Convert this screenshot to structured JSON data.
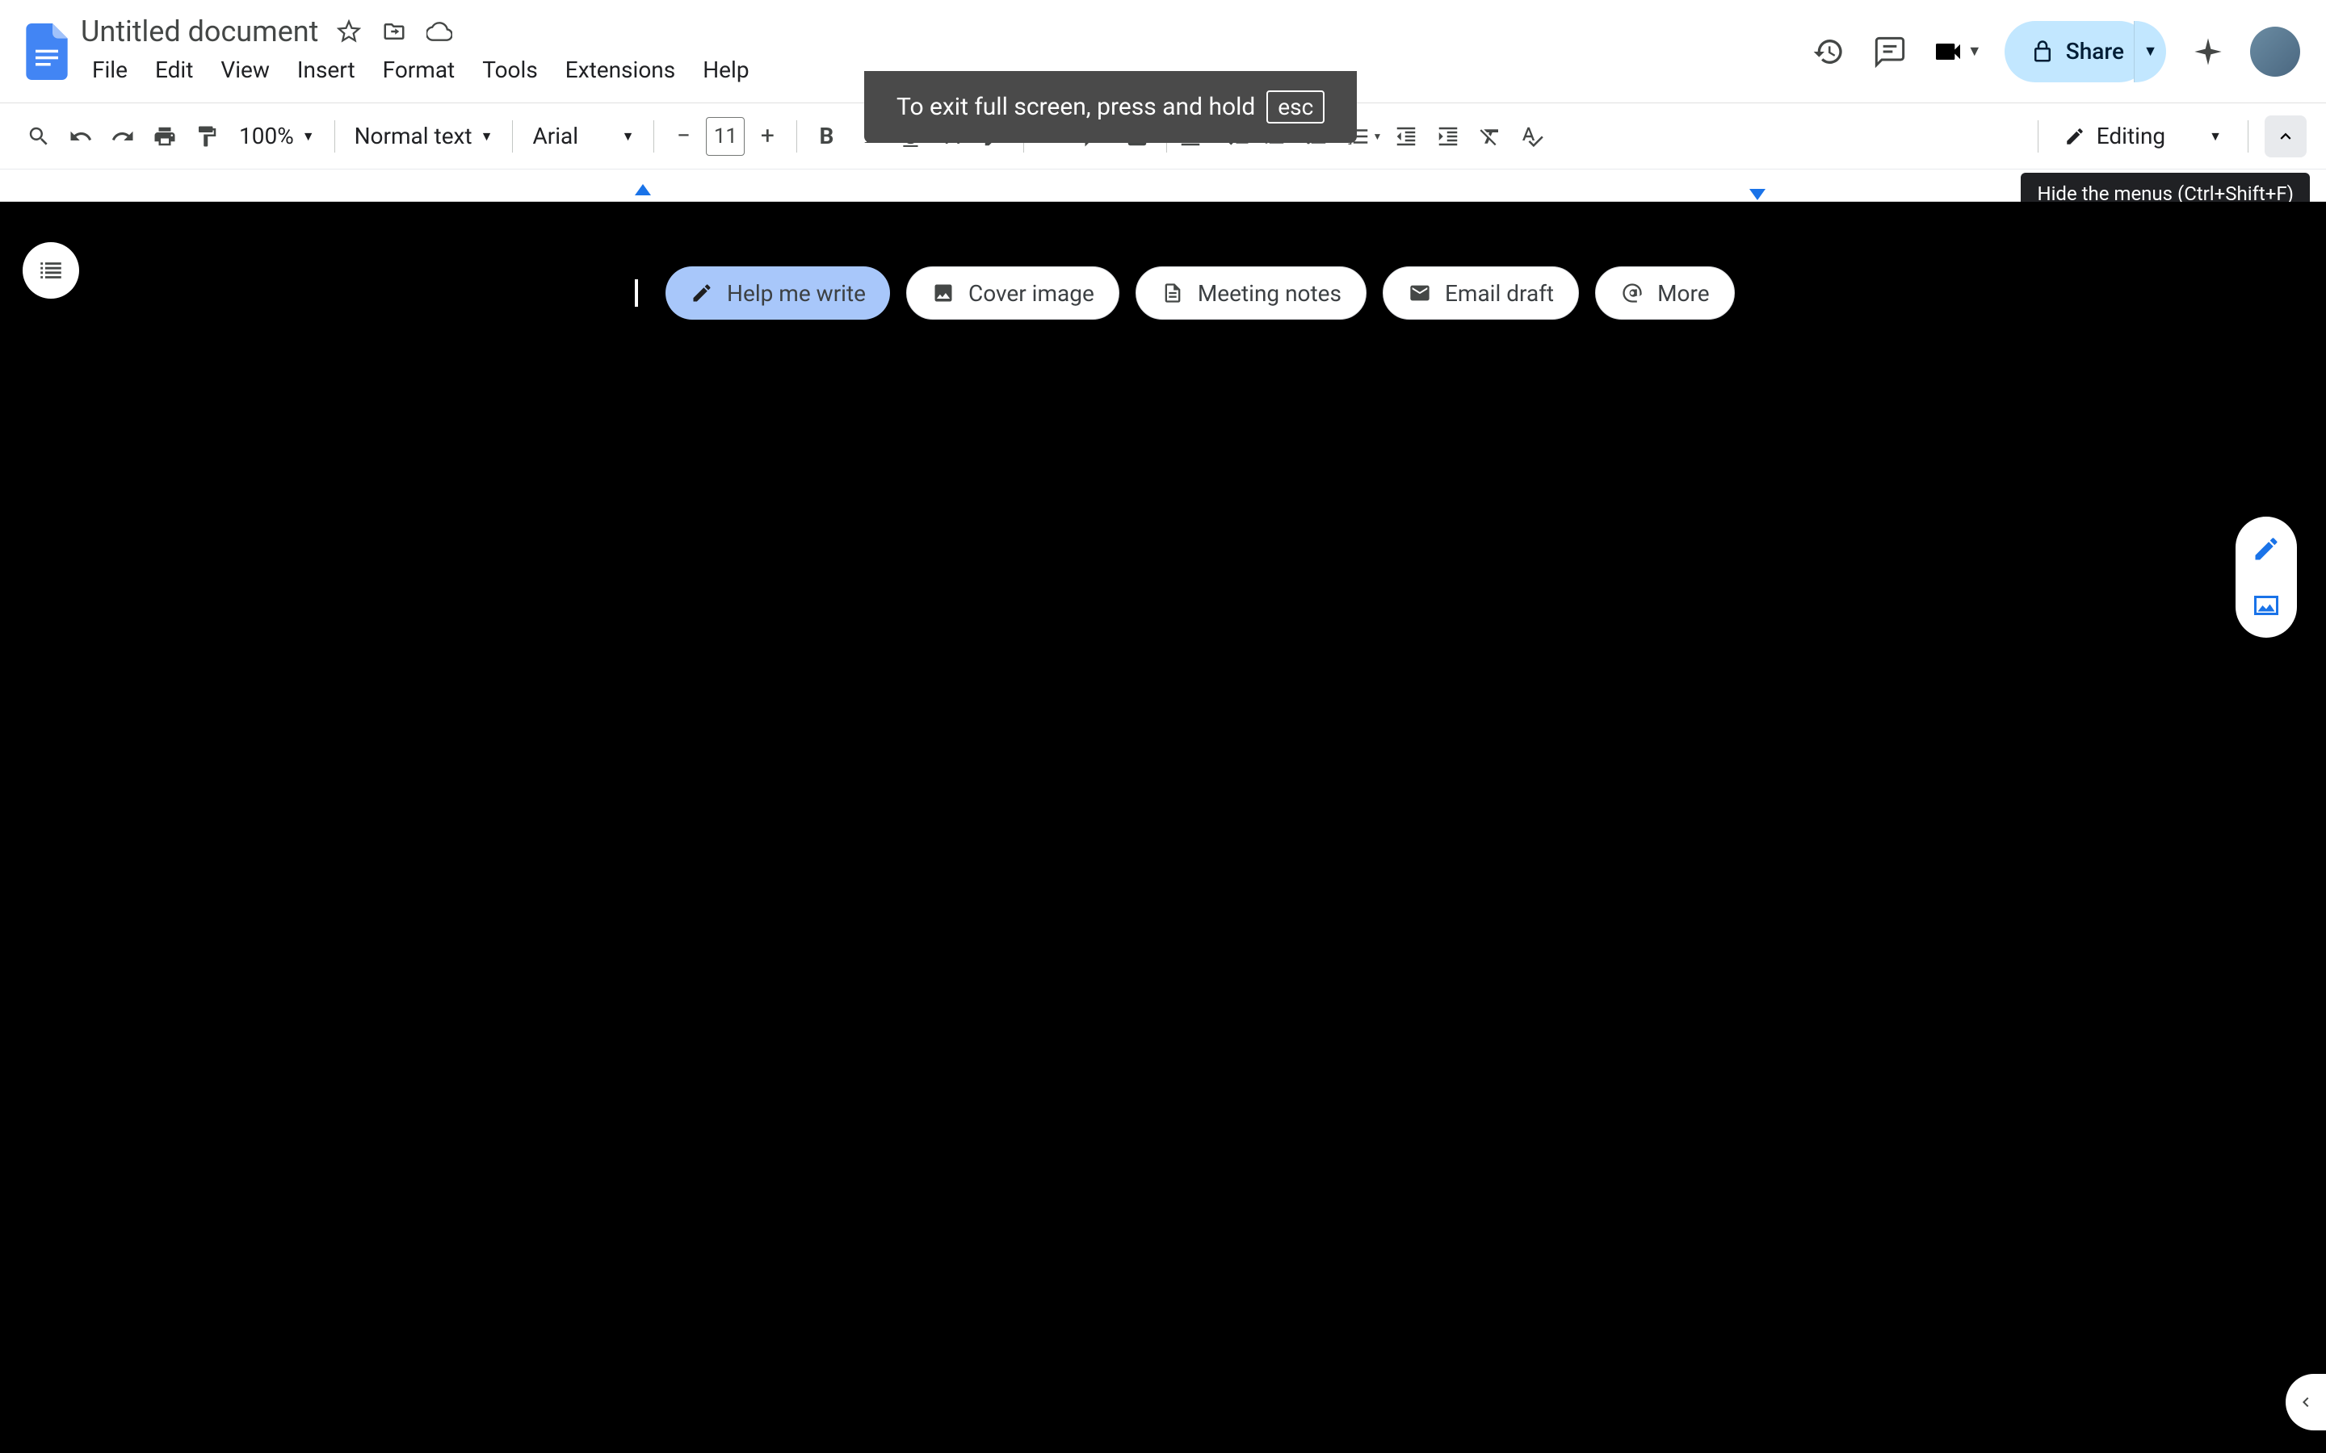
{
  "header": {
    "title": "Untitled document",
    "menus": [
      "File",
      "Edit",
      "View",
      "Insert",
      "Format",
      "Tools",
      "Extensions",
      "Help"
    ],
    "share_label": "Share"
  },
  "toolbar": {
    "zoom": "100%",
    "style": "Normal text",
    "font": "Arial",
    "font_size": "11",
    "mode": "Editing"
  },
  "chips": {
    "help_write": "Help me write",
    "cover_image": "Cover image",
    "meeting_notes": "Meeting notes",
    "email_draft": "Email draft",
    "more": "More"
  },
  "fullscreen_toast": {
    "text": "To exit full screen, press and hold",
    "key": "esc"
  },
  "tooltip": "Hide the menus (Ctrl+Shift+F)"
}
